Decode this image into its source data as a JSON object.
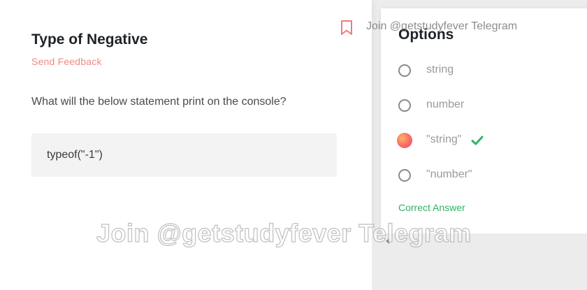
{
  "question": {
    "title": "Type of Negative",
    "feedback_link": "Send Feedback",
    "prompt": "What will the below statement print on the console?",
    "code": "typeof(\"-1\")"
  },
  "options_panel": {
    "title": "Options",
    "options": [
      {
        "label": "string",
        "selected": false,
        "correct": false
      },
      {
        "label": "number",
        "selected": false,
        "correct": false
      },
      {
        "label": "\"string\"",
        "selected": true,
        "correct": true
      },
      {
        "label": "\"number\"",
        "selected": false,
        "correct": false
      }
    ],
    "correct_answer_label": "Correct Answer"
  },
  "watermark": {
    "top": "Join @getstudyfever Telegram",
    "center": "Join @getstudyfever Telegram"
  },
  "icons": {
    "bookmark": "bookmark-icon",
    "check": "check-icon"
  },
  "colors": {
    "feedback": "#f08a7e",
    "correct": "#2fb463",
    "selected_radio_gradient": [
      "#ffb36b",
      "#f76a63",
      "#ec4d86"
    ],
    "bookmark": "#f07a7a"
  }
}
